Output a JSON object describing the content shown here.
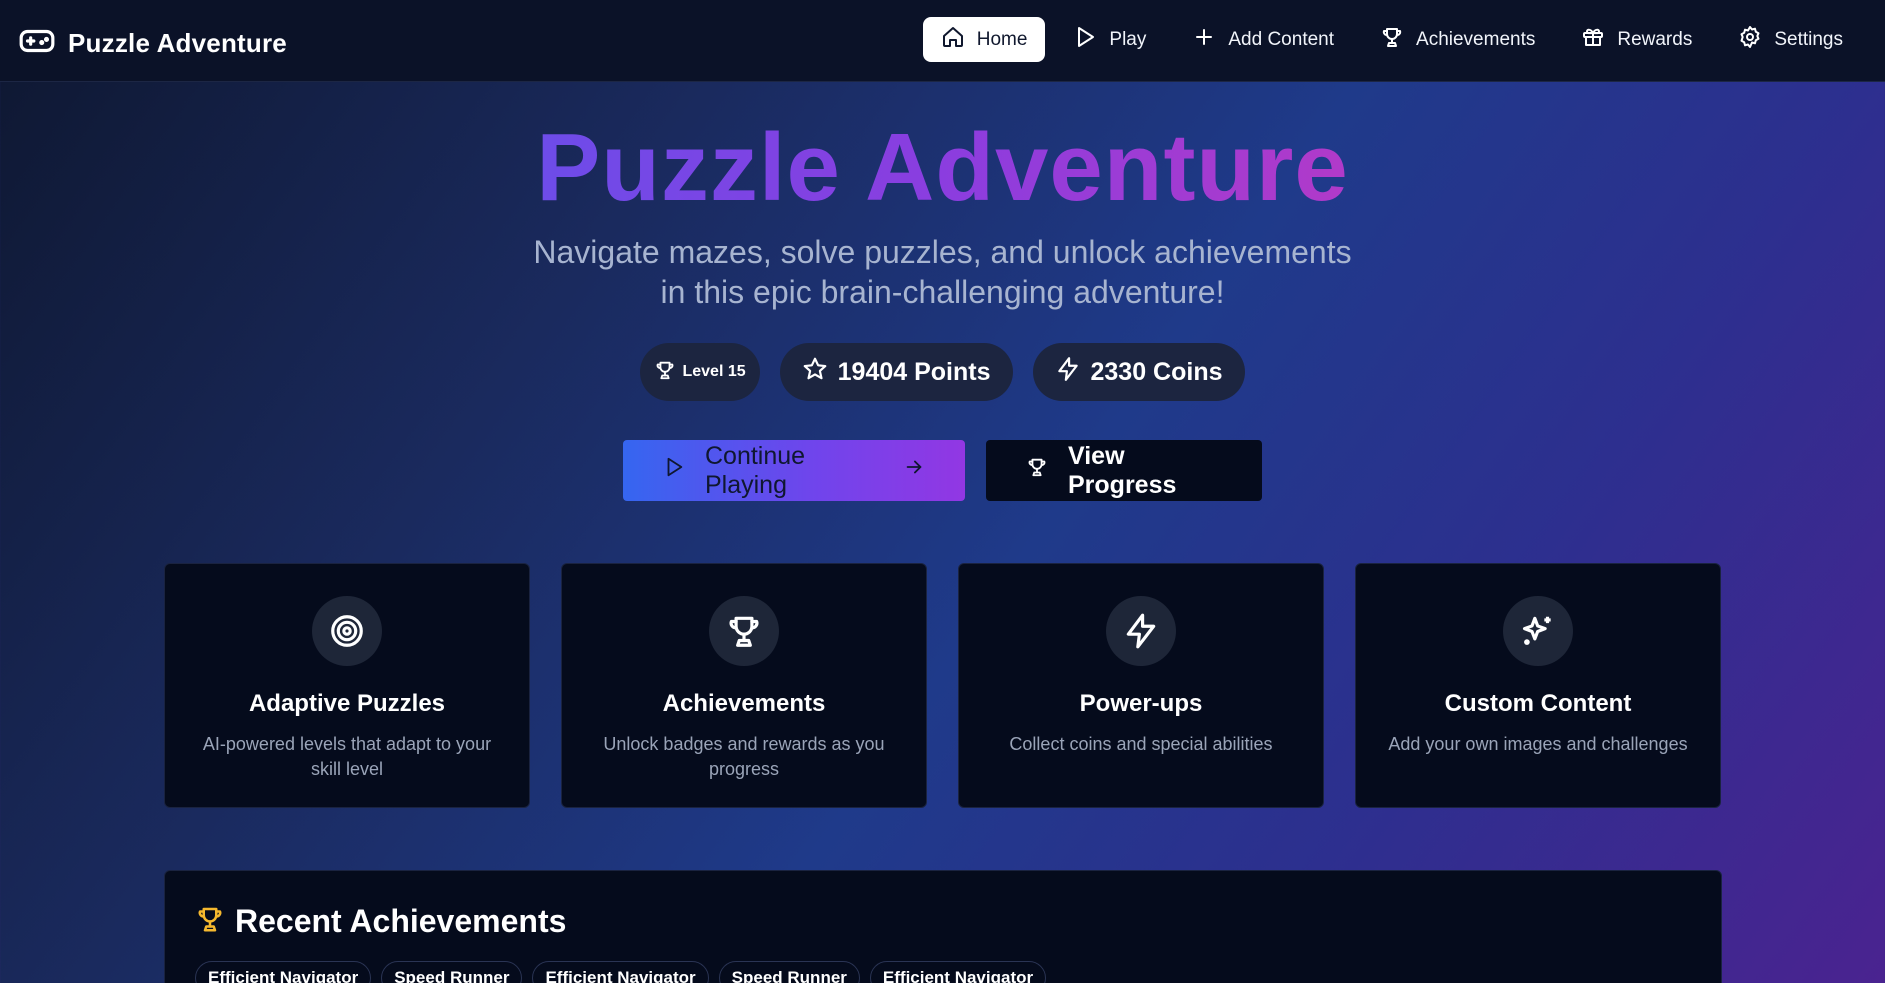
{
  "nav": {
    "brand": "Puzzle Adventure",
    "items": [
      {
        "label": "Home",
        "icon": "home-icon",
        "active": true
      },
      {
        "label": "Play",
        "icon": "play-icon"
      },
      {
        "label": "Add Content",
        "icon": "plus-icon"
      },
      {
        "label": "Achievements",
        "icon": "trophy-icon"
      },
      {
        "label": "Rewards",
        "icon": "gift-icon"
      },
      {
        "label": "Settings",
        "icon": "gear-icon"
      }
    ]
  },
  "hero": {
    "title": "Puzzle Adventure",
    "subtitle_line1": "Navigate mazes, solve puzzles, and unlock achievements",
    "subtitle_line2": "in this epic brain-challenging adventure!"
  },
  "stats": {
    "level": "Level 15",
    "points": "19404 Points",
    "coins": "2330 Coins"
  },
  "actions": {
    "continue": "Continue Playing",
    "progress": "View Progress"
  },
  "features": [
    {
      "title": "Adaptive Puzzles",
      "desc": "AI-powered levels that adapt to your skill level",
      "icon": "target-icon"
    },
    {
      "title": "Achievements",
      "desc": "Unlock badges and rewards as you progress",
      "icon": "trophy-icon"
    },
    {
      "title": "Power-ups",
      "desc": "Collect coins and special abilities",
      "icon": "lightning-icon"
    },
    {
      "title": "Custom Content",
      "desc": "Add your own images and challenges",
      "icon": "sparkles-icon"
    }
  ],
  "recent": {
    "title": "Recent Achievements",
    "badges": [
      "Efficient Navigator",
      "Speed Runner",
      "Efficient Navigator",
      "Speed Runner",
      "Efficient Navigator"
    ]
  },
  "colors": {
    "accent_gold": "#f5b82e",
    "card_bg": "#050b1c",
    "nav_bg": "#0b1228"
  }
}
